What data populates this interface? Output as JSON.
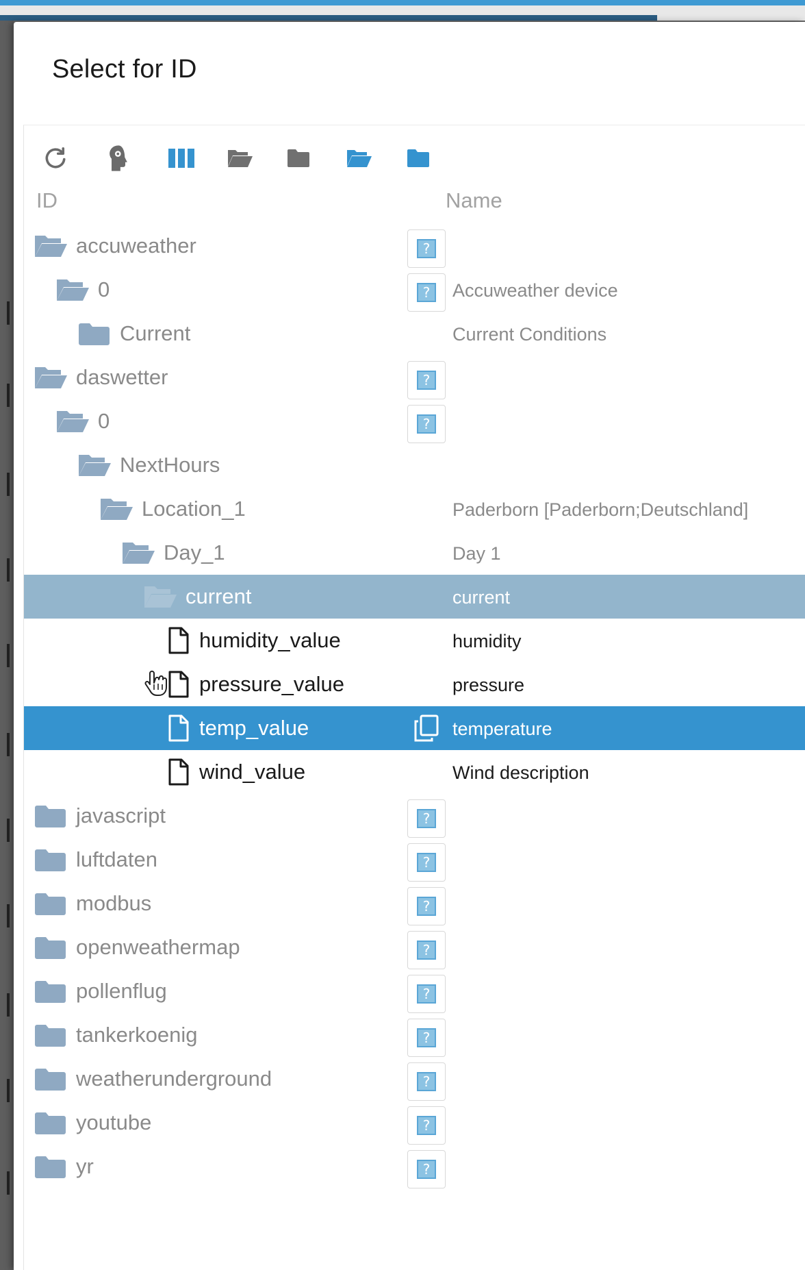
{
  "dialog": {
    "title": "Select for ID"
  },
  "toolbar": {
    "buttons": [
      {
        "icon": "refresh-icon"
      },
      {
        "icon": "expert-mode-icon"
      },
      {
        "icon": "columns-icon"
      },
      {
        "icon": "expand-all-icon"
      },
      {
        "icon": "collapse-all-icon"
      },
      {
        "icon": "expand-one-level-icon"
      },
      {
        "icon": "collapse-one-level-icon"
      }
    ]
  },
  "columns": {
    "id": "ID",
    "name": "Name"
  },
  "colors": {
    "highlight_row": "#93b5cc",
    "selected_row": "#3593cf",
    "folder_icon": "#8fa9c2",
    "toolbar_blue": "#3593cf",
    "toolbar_gray": "#707070"
  },
  "tree": [
    {
      "label": "accuweather",
      "name": "",
      "icon": "folder-open-icon",
      "depth": 0,
      "qbox": true,
      "kind": "folder"
    },
    {
      "label": "0",
      "name": "Accuweather device",
      "icon": "folder-open-icon",
      "depth": 1,
      "qbox": true,
      "kind": "folder"
    },
    {
      "label": "Current",
      "name": "Current Conditions",
      "icon": "folder-closed-icon",
      "depth": 2,
      "qbox": false,
      "kind": "folder"
    },
    {
      "label": "daswetter",
      "name": "",
      "icon": "folder-open-icon",
      "depth": 0,
      "qbox": true,
      "kind": "folder"
    },
    {
      "label": "0",
      "name": "",
      "icon": "folder-open-icon",
      "depth": 1,
      "qbox": true,
      "kind": "folder"
    },
    {
      "label": "NextHours",
      "name": "",
      "icon": "folder-open-icon",
      "depth": 2,
      "qbox": false,
      "kind": "folder"
    },
    {
      "label": "Location_1",
      "name": "Paderborn [Paderborn;Deutschland]",
      "icon": "folder-open-icon",
      "depth": 3,
      "qbox": false,
      "kind": "folder"
    },
    {
      "label": "Day_1",
      "name": "Day 1",
      "icon": "folder-open-icon",
      "depth": 4,
      "qbox": false,
      "kind": "folder"
    },
    {
      "label": "current",
      "name": "current",
      "icon": "folder-open-icon",
      "depth": 5,
      "qbox": false,
      "kind": "folder",
      "state": "highlighted"
    },
    {
      "label": "humidity_value",
      "name": "humidity",
      "icon": "file-icon",
      "depth": 6,
      "qbox": false,
      "kind": "leaf"
    },
    {
      "label": "pressure_value",
      "name": "pressure",
      "icon": "file-icon",
      "depth": 6,
      "qbox": false,
      "kind": "leaf",
      "cursor": "hand-pointer-icon"
    },
    {
      "label": "temp_value",
      "name": "temperature",
      "icon": "file-icon",
      "depth": 6,
      "qbox": false,
      "kind": "leaf",
      "state": "selected",
      "action_icon": "copy-icon"
    },
    {
      "label": "wind_value",
      "name": "Wind description",
      "icon": "file-icon",
      "depth": 6,
      "qbox": false,
      "kind": "leaf"
    },
    {
      "label": "javascript",
      "name": "",
      "icon": "folder-closed-icon",
      "depth": 0,
      "qbox": true,
      "kind": "folder"
    },
    {
      "label": "luftdaten",
      "name": "",
      "icon": "folder-closed-icon",
      "depth": 0,
      "qbox": true,
      "kind": "folder"
    },
    {
      "label": "modbus",
      "name": "",
      "icon": "folder-closed-icon",
      "depth": 0,
      "qbox": true,
      "kind": "folder"
    },
    {
      "label": "openweathermap",
      "name": "",
      "icon": "folder-closed-icon",
      "depth": 0,
      "qbox": true,
      "kind": "folder"
    },
    {
      "label": "pollenflug",
      "name": "",
      "icon": "folder-closed-icon",
      "depth": 0,
      "qbox": true,
      "kind": "folder"
    },
    {
      "label": "tankerkoenig",
      "name": "",
      "icon": "folder-closed-icon",
      "depth": 0,
      "qbox": true,
      "kind": "folder"
    },
    {
      "label": "weatherunderground",
      "name": "",
      "icon": "folder-closed-icon",
      "depth": 0,
      "qbox": true,
      "kind": "folder"
    },
    {
      "label": "youtube",
      "name": "",
      "icon": "folder-closed-icon",
      "depth": 0,
      "qbox": true,
      "kind": "folder"
    },
    {
      "label": "yr",
      "name": "",
      "icon": "folder-closed-icon",
      "depth": 0,
      "qbox": true,
      "kind": "folder"
    }
  ]
}
